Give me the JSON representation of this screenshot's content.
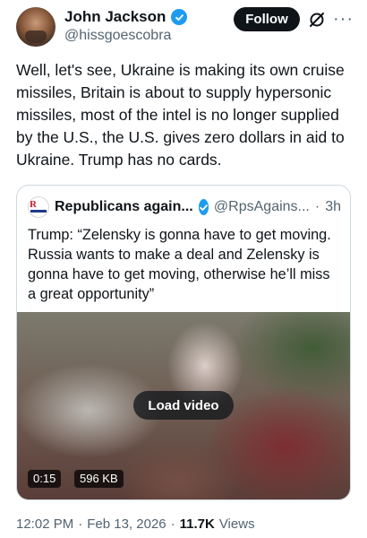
{
  "author": {
    "display_name": "John Jackson",
    "handle": "@hissgoescobra",
    "verified": true
  },
  "follow_button": {
    "label": "Follow"
  },
  "more_icon": {
    "glyph": "···"
  },
  "tweet": {
    "text": "Well, let's see, Ukraine is making its own cruise missiles, Britain is about to supply hypersonic missiles, most of the intel is no longer supplied by the U.S., the U.S. gives zero dollars in aid to Ukraine. Trump has no cards."
  },
  "quoted_tweet": {
    "display_name": "Republicans again...",
    "handle": "@RpsAgains...",
    "separator": "·",
    "time": "3h",
    "text": "Trump: “Zelensky is gonna have to get moving. Russia wants to make a deal and Zelensky is gonna have to get moving, otherwise he’ll miss a great opportunity”",
    "video": {
      "load_label": "Load video",
      "duration": "0:15",
      "size": "596 KB"
    }
  },
  "footer": {
    "time": "12:02 PM",
    "date": "Feb 13, 2026",
    "separator": "·",
    "views_count": "11.7K",
    "views_label": "Views"
  },
  "colors": {
    "verified_blue": "#1d9bf0",
    "text_primary": "#0f1419",
    "text_secondary": "#536471",
    "border": "#cfd9de"
  }
}
